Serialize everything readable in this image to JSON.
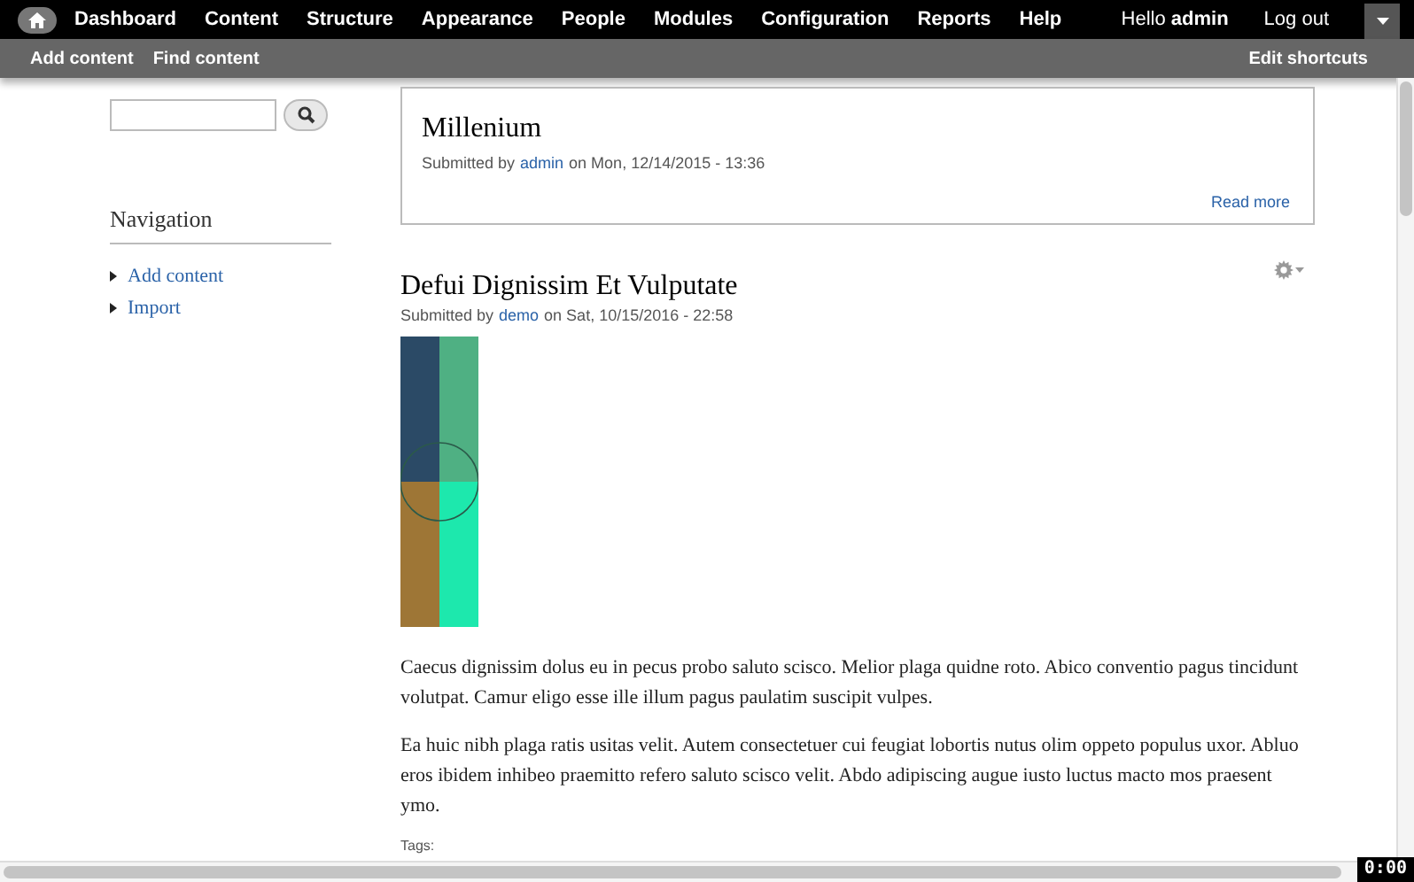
{
  "toolbar": {
    "menu": [
      {
        "label": "Dashboard"
      },
      {
        "label": "Content"
      },
      {
        "label": "Structure"
      },
      {
        "label": "Appearance"
      },
      {
        "label": "People"
      },
      {
        "label": "Modules"
      },
      {
        "label": "Configuration"
      },
      {
        "label": "Reports"
      },
      {
        "label": "Help"
      }
    ],
    "greeting": "Hello **admin**",
    "logout": "Log out"
  },
  "shortcuts": {
    "items": [
      "Add content",
      "Find content"
    ],
    "edit": "Edit shortcuts"
  },
  "sidebar": {
    "navigation": {
      "title": "Navigation",
      "items": [
        "Add content",
        "Import"
      ]
    }
  },
  "teaser": {
    "title": "Millenium",
    "submitted_prefix": "Submitted by",
    "author": "admin",
    "submitted_suffix": "on Mon, 12/14/2015 - 13:36",
    "read_more": "Read more"
  },
  "article": {
    "title": "Defui Dignissim Et Vulputate",
    "submitted_prefix": "Submitted by",
    "author": "demo",
    "submitted_suffix": "on Sat, 10/15/2016 - 22:58",
    "paragraphs": [
      "Caecus dignissim dolus eu in pecus probo saluto scisco. Melior plaga quidne roto. Abico conventio pagus tincidunt volutpat. Camur eligo esse ille illum pagus paulatim suscipit vulpes.",
      "Ea huic nibh plaga ratis usitas velit. Autem consectetuer cui feugiat lobortis nutus olim oppeto populus uxor. Abluo eros ibidem inhibeo praemitto refero saluto scisco velit. Abdo adipiscing augue iusto luctus macto mos praesent ymo."
    ],
    "tags_label": "Tags:"
  },
  "timer": "0:00"
}
